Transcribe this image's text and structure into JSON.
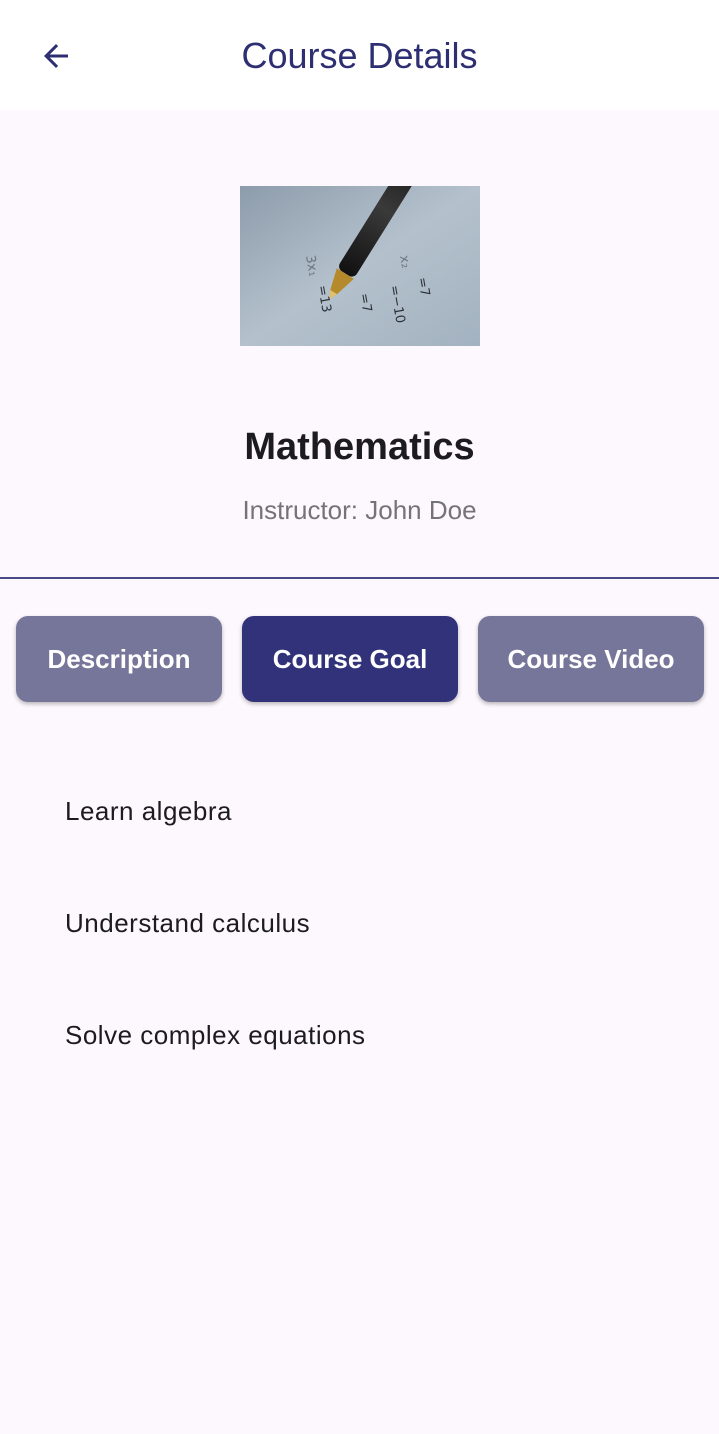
{
  "app_bar": {
    "title": "Course Details",
    "back_icon": "arrow-left-icon"
  },
  "course": {
    "image_icon": "pencil-math-photo",
    "name": "Mathematics",
    "instructor": "Instructor: John Doe"
  },
  "tabs": [
    {
      "label": "Description",
      "selected": false
    },
    {
      "label": "Course Goal",
      "selected": true
    },
    {
      "label": "Course Video",
      "selected": false
    }
  ],
  "goals": [
    "Learn algebra",
    "Understand calculus",
    "Solve complex equations"
  ],
  "colors": {
    "primary": "#32327a",
    "tab_inactive": "#76759a",
    "background": "#fdf8fd",
    "title": "#2e2e72"
  }
}
